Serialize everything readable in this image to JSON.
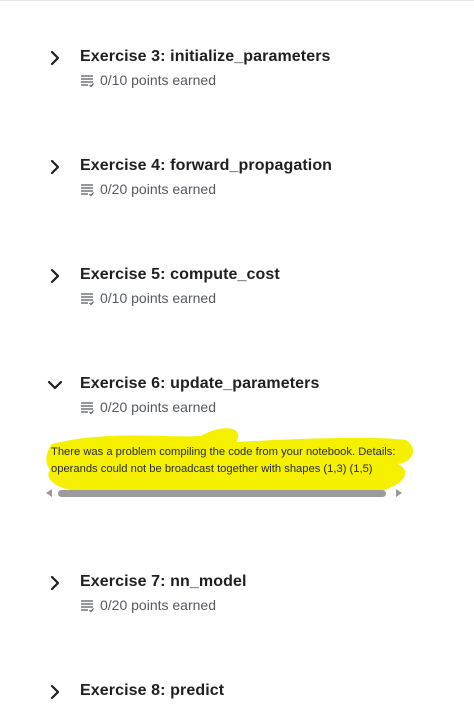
{
  "exercises": [
    {
      "title": "Exercise 3: initialize_parameters",
      "points": "0/10 points earned",
      "expanded": false,
      "icon": "chevron-right-icon"
    },
    {
      "title": "Exercise 4: forward_propagation",
      "points": "0/20 points earned",
      "expanded": false,
      "icon": "chevron-right-icon"
    },
    {
      "title": "Exercise 5: compute_cost",
      "points": "0/10 points earned",
      "expanded": false,
      "icon": "chevron-right-icon"
    },
    {
      "title": "Exercise 6: update_parameters",
      "points": "0/20 points earned",
      "expanded": true,
      "icon": "chevron-down-icon"
    },
    {
      "title": "Exercise 7: nn_model",
      "points": "0/20 points earned",
      "expanded": false,
      "icon": "chevron-right-icon"
    },
    {
      "title": "Exercise 8: predict",
      "points": "",
      "expanded": false,
      "icon": "chevron-right-icon"
    }
  ],
  "error": {
    "message": "There was a problem compiling the code from your notebook. Details: operands could not be broadcast together with shapes (1,3) (1,5)",
    "highlight_color": "#f4f000"
  },
  "colors": {
    "points_text": "#555a61",
    "title_text": "#1f1f1f"
  }
}
